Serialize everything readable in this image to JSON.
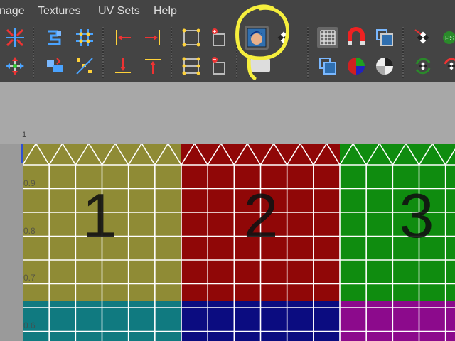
{
  "menu": {
    "items": [
      {
        "label": "nage"
      },
      {
        "label": "Textures"
      },
      {
        "label": "UV Sets"
      },
      {
        "label": "Help"
      }
    ]
  },
  "toolbar": {
    "icons": {
      "flip_icon": "flip-icon",
      "move_icon": "move-icon",
      "checker_icon": "checker-icon",
      "magnet_icon": "magnet-icon"
    },
    "ps_badge": "PS"
  },
  "uv_editor": {
    "ruler_top_label": "1",
    "v_ticks": [
      "0.9",
      "0.8",
      "0.7",
      "0.6"
    ],
    "tiles": [
      {
        "number": "1",
        "color": "#8f8b35"
      },
      {
        "number": "2",
        "color": "#900707"
      },
      {
        "number": "3",
        "color": "#0f8c0f"
      }
    ],
    "lower_colors": [
      "#107a80",
      "#0b0c80",
      "#8c0a8c"
    ],
    "highlight_color": "#f6ef3d"
  }
}
